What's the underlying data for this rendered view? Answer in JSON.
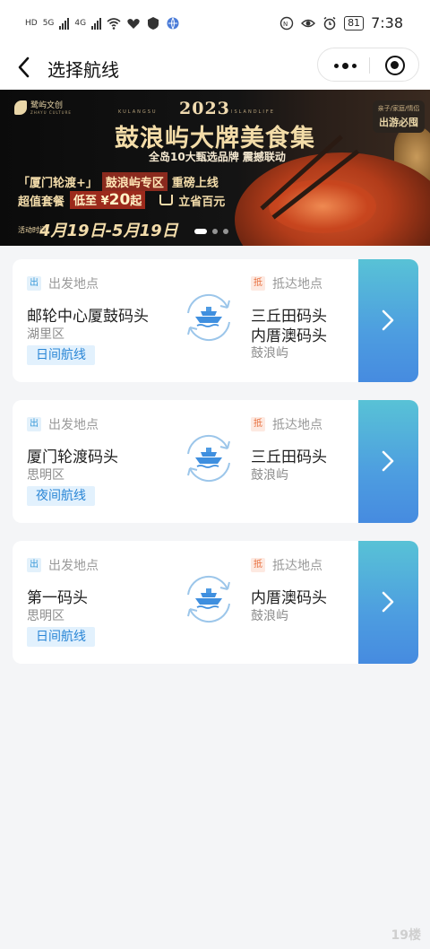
{
  "status_bar": {
    "net1": "HD",
    "gen1": "5G",
    "gen2": "4G",
    "battery": "81",
    "time": "7:38"
  },
  "nav": {
    "title": "选择航线"
  },
  "banner": {
    "logo_text": "鹭屿文创",
    "logo_sub": "ZHAYU CULTURE",
    "year": "2023",
    "en_left": "KULANGSU",
    "en_right": "ISLANDLIFE",
    "title": "鼓浪屿大牌美食集",
    "subtitle": "全岛10大甄选品牌 震撼联动",
    "tag_line1": "亲子/家庭/情侣",
    "tag_line2": "出游必囤",
    "promo_a": "「厦门轮渡+」",
    "promo_b": "鼓浪屿专区",
    "promo_c": "重磅上线",
    "deal_a": "超值套餐",
    "deal_b": "低至",
    "deal_currency": "¥",
    "deal_price": "20",
    "deal_unit": "起",
    "deal_save": "立省百元",
    "date_label": "活动时间",
    "date_value": "4月19日-5月19日",
    "slides": 3,
    "active_slide": 1
  },
  "routes": [
    {
      "from_tag": "出",
      "from_label": "出发地点",
      "from_name": "邮轮中心厦鼓码头",
      "from_district": "湖里区",
      "badge": "日间航线",
      "to_tag": "抵",
      "to_label": "抵达地点",
      "to_names": [
        "三丘田码头",
        "内厝澳码头"
      ],
      "to_district": "鼓浪屿"
    },
    {
      "from_tag": "出",
      "from_label": "出发地点",
      "from_name": "厦门轮渡码头",
      "from_district": "思明区",
      "badge": "夜间航线",
      "to_tag": "抵",
      "to_label": "抵达地点",
      "to_names": [
        "三丘田码头"
      ],
      "to_district": "鼓浪屿"
    },
    {
      "from_tag": "出",
      "from_label": "出发地点",
      "from_name": "第一码头",
      "from_district": "思明区",
      "badge": "日间航线",
      "to_tag": "抵",
      "to_label": "抵达地点",
      "to_names": [
        "内厝澳码头"
      ],
      "to_district": "鼓浪屿"
    }
  ],
  "watermark": "19楼",
  "colors": {
    "accent_blue": "#2a86d6",
    "tag_from": "#3a9ad9",
    "tag_to": "#e8703f",
    "go_gradient_top": "#58c2d6",
    "go_gradient_bottom": "#468be0"
  }
}
